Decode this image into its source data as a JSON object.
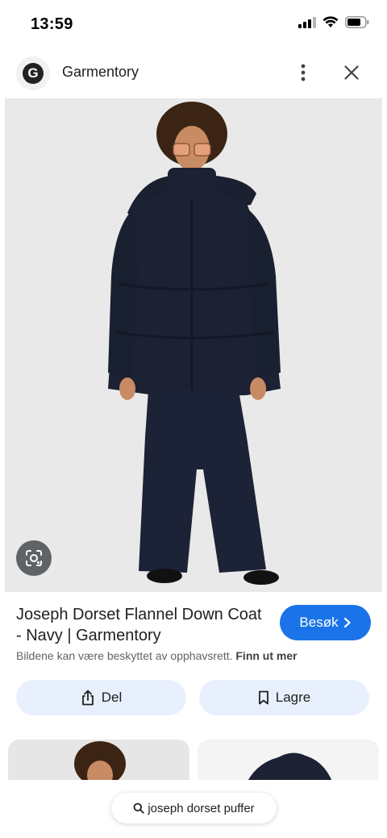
{
  "status_bar": {
    "time": "13:59"
  },
  "header": {
    "site_name": "Garmentory",
    "logo_letter": "G"
  },
  "result": {
    "title": "Joseph Dorset Flannel Down Coat - Navy | Garmentory",
    "visit_label": "Besøk",
    "copyright_text": "Bildene kan være beskyttet av opphavsrett.",
    "learn_more_label": "Finn ut mer"
  },
  "actions": {
    "share_label": "Del",
    "save_label": "Lagre"
  },
  "search_chip": {
    "query": "joseph dorset puffer"
  },
  "colors": {
    "accent": "#1a73e8",
    "action_bg": "#e8f0fe",
    "coat_navy": "#1c2233"
  },
  "icons": [
    "signal-icon",
    "wifi-icon",
    "battery-icon",
    "more-vert-icon",
    "close-icon",
    "lens-icon",
    "share-icon",
    "bookmark-icon",
    "chevron-right-icon",
    "search-icon"
  ]
}
